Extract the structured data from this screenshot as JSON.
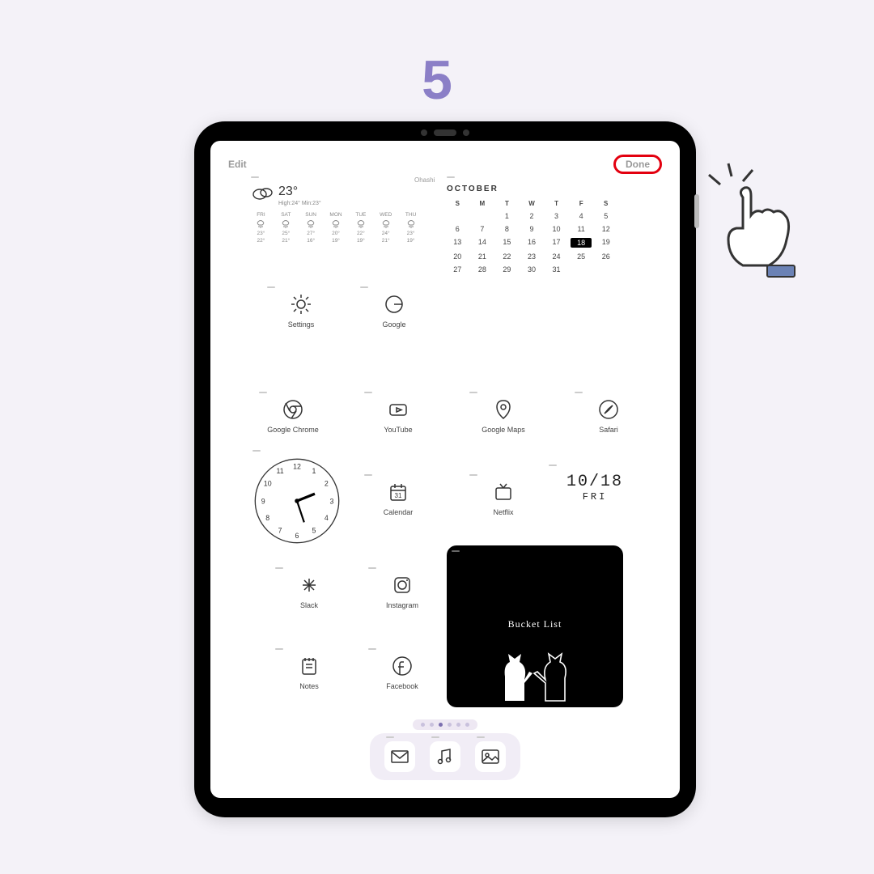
{
  "step": "5",
  "topbar": {
    "edit": "Edit",
    "done": "Done"
  },
  "weather": {
    "location": "Ohashi",
    "temp": "23°",
    "hilo": "High:24° Min:23°",
    "days": [
      {
        "d": "FRI",
        "h": "23°",
        "l": "22°"
      },
      {
        "d": "SAT",
        "h": "25°",
        "l": "21°"
      },
      {
        "d": "SUN",
        "h": "27°",
        "l": "16°"
      },
      {
        "d": "MON",
        "h": "20°",
        "l": "19°"
      },
      {
        "d": "TUE",
        "h": "22°",
        "l": "19°"
      },
      {
        "d": "WED",
        "h": "24°",
        "l": "21°"
      },
      {
        "d": "THU",
        "h": "23°",
        "l": "19°"
      }
    ]
  },
  "calendar": {
    "month": "OCTOBER",
    "dow": [
      "S",
      "M",
      "T",
      "W",
      "T",
      "F",
      "S"
    ],
    "leading_blanks": 2,
    "days": 31,
    "today": 18
  },
  "apps_row1": [
    {
      "name": "Settings",
      "icon": "gear"
    },
    {
      "name": "Google",
      "icon": "google"
    }
  ],
  "apps_row2": [
    {
      "name": "Google Chrome",
      "icon": "chrome"
    },
    {
      "name": "YouTube",
      "icon": "youtube"
    },
    {
      "name": "Google Maps",
      "icon": "maps"
    },
    {
      "name": "Safari",
      "icon": "safari"
    }
  ],
  "apps_row3": [
    {
      "name": "Calendar",
      "icon": "calendar31"
    },
    {
      "name": "Netflix",
      "icon": "tv"
    }
  ],
  "apps_row4": [
    {
      "name": "Slack",
      "icon": "slack"
    },
    {
      "name": "Instagram",
      "icon": "instagram"
    }
  ],
  "apps_row5": [
    {
      "name": "Notes",
      "icon": "notes"
    },
    {
      "name": "Facebook",
      "icon": "facebook"
    }
  ],
  "date_widget": {
    "date": "10/18",
    "day": "FRI"
  },
  "bucket": {
    "title": "Bucket List"
  },
  "dock": [
    "mail",
    "music",
    "photos"
  ],
  "pager_count": 6,
  "pager_active": 2
}
